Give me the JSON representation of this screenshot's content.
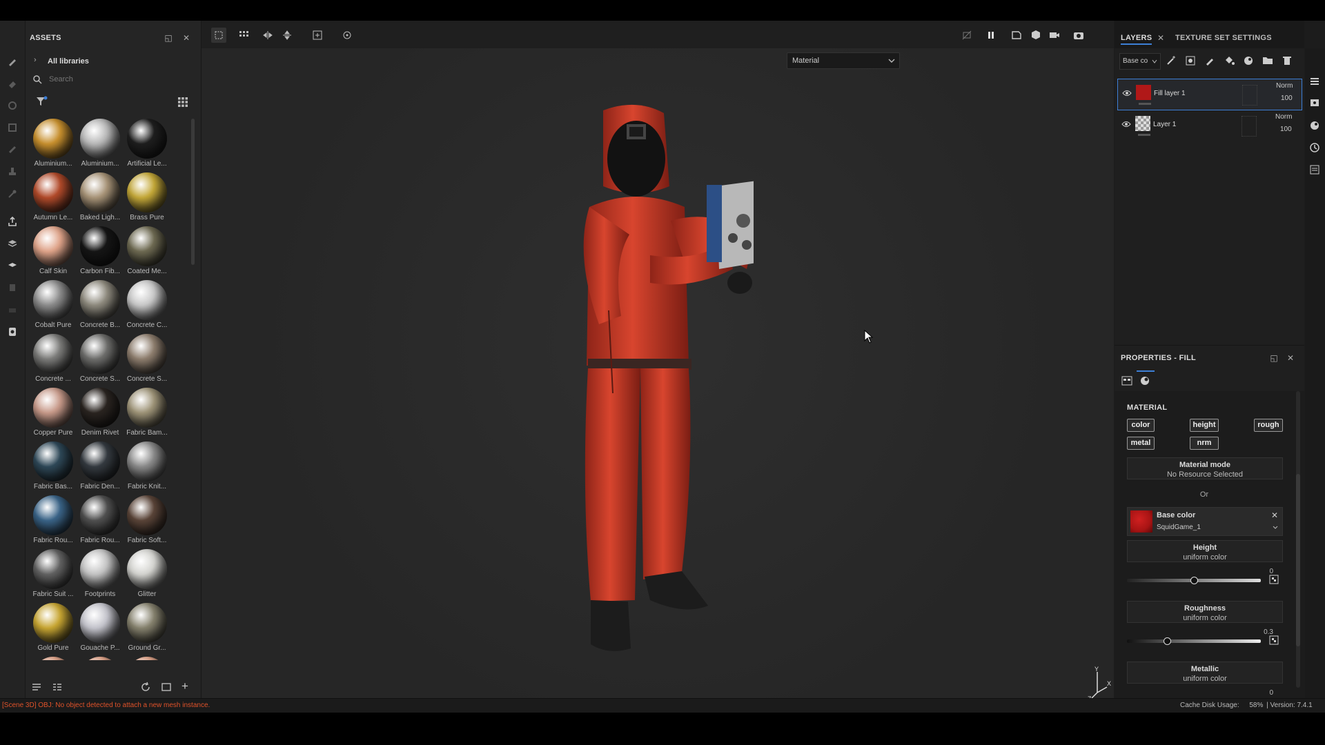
{
  "assets_panel": {
    "title": "ASSETS",
    "breadcrumb": "All libraries",
    "search_placeholder": "Search",
    "items": [
      {
        "label": "Aluminium...",
        "color": "#c8902e",
        "marked": true
      },
      {
        "label": "Aluminium...",
        "color": "#b8b8b8",
        "marked": false
      },
      {
        "label": "Artificial Le...",
        "color": "#1e1e1e",
        "marked": false
      },
      {
        "label": "Autumn Le...",
        "color": "#b24a2a",
        "marked": true
      },
      {
        "label": "Baked Ligh...",
        "color": "#a89478",
        "marked": false
      },
      {
        "label": "Brass Pure",
        "color": "#c4a838",
        "marked": false
      },
      {
        "label": "Calf Skin",
        "color": "#e0a48a",
        "marked": false
      },
      {
        "label": "Carbon Fib...",
        "color": "#151515",
        "marked": true
      },
      {
        "label": "Coated Me...",
        "color": "#6e6a52",
        "marked": true
      },
      {
        "label": "Cobalt Pure",
        "color": "#8c8c8c",
        "marked": false
      },
      {
        "label": "Concrete B...",
        "color": "#8e8a7e",
        "marked": true
      },
      {
        "label": "Concrete C...",
        "color": "#c8c8c8",
        "marked": true
      },
      {
        "label": "Concrete ...",
        "color": "#7c7c7a",
        "marked": true
      },
      {
        "label": "Concrete S...",
        "color": "#6e6e6c",
        "marked": true
      },
      {
        "label": "Concrete S...",
        "color": "#8e7e6e",
        "marked": true
      },
      {
        "label": "Copper Pure",
        "color": "#c89a8a",
        "marked": false
      },
      {
        "label": "Denim Rivet",
        "color": "#2a2420",
        "marked": false
      },
      {
        "label": "Fabric Bam...",
        "color": "#9e9478",
        "marked": false
      },
      {
        "label": "Fabric Bas...",
        "color": "#2e4858",
        "marked": false
      },
      {
        "label": "Fabric Den...",
        "color": "#343a40",
        "marked": false
      },
      {
        "label": "Fabric Knit...",
        "color": "#8a8a8a",
        "marked": false
      },
      {
        "label": "Fabric Rou...",
        "color": "#3a6488",
        "marked": false
      },
      {
        "label": "Fabric Rou...",
        "color": "#505050",
        "marked": false
      },
      {
        "label": "Fabric Soft...",
        "color": "#5a4438",
        "marked": true
      },
      {
        "label": "Fabric Suit ...",
        "color": "#626262",
        "marked": true
      },
      {
        "label": "Footprints",
        "color": "#c4c4c4",
        "marked": true
      },
      {
        "label": "Glitter",
        "color": "#d4d4d0",
        "marked": true
      },
      {
        "label": "Gold Pure",
        "color": "#c8a632",
        "marked": false
      },
      {
        "label": "Gouache P...",
        "color": "#c4c4cc",
        "marked": true
      },
      {
        "label": "Ground Gr...",
        "color": "#86826e",
        "marked": true
      },
      {
        "label": "",
        "color": "#e0a48a",
        "marked": false
      },
      {
        "label": "",
        "color": "#e0a48a",
        "marked": false
      },
      {
        "label": "",
        "color": "#e0a48a",
        "marked": false
      }
    ]
  },
  "viewport": {
    "mode_select": "Material"
  },
  "layers_panel": {
    "tab_layers": "LAYERS",
    "tab_texture_set": "TEXTURE SET SETTINGS",
    "channel_select": "Base co",
    "layers": [
      {
        "name": "Fill layer 1",
        "blend": "Norm",
        "opacity": "100",
        "thumb_color": "#b01818",
        "selected": true
      },
      {
        "name": "Layer 1",
        "blend": "Norm",
        "opacity": "100",
        "thumb_color": "#d8d8d8",
        "selected": false
      }
    ]
  },
  "properties_panel": {
    "title": "PROPERTIES - FILL",
    "section": "MATERIAL",
    "channel_tags": [
      "color",
      "height",
      "rough",
      "metal",
      "nrm"
    ],
    "material_mode": {
      "title": "Material mode",
      "value": "No Resource Selected"
    },
    "or_label": "Or",
    "base_color": {
      "title": "Base color",
      "resource": "SquidGame_1",
      "swatch": "#a81414"
    },
    "height": {
      "title": "Height",
      "mode": "uniform color",
      "value": "0",
      "fraction": 0.5
    },
    "roughness": {
      "title": "Roughness",
      "mode": "uniform color",
      "value": "0.3",
      "fraction": 0.3
    },
    "metallic": {
      "title": "Metallic",
      "mode": "uniform color",
      "value": "0"
    }
  },
  "status_bar": {
    "message": "[Scene 3D] OBJ: No object detected to attach a new mesh instance.",
    "message_color": "#e0522a",
    "cache_label": "Cache Disk Usage:",
    "cache_value": "58%",
    "version": "| Version: 7.4.1"
  },
  "colors": {
    "accent": "#3d7fd6",
    "suit_red": "#c0392b"
  }
}
